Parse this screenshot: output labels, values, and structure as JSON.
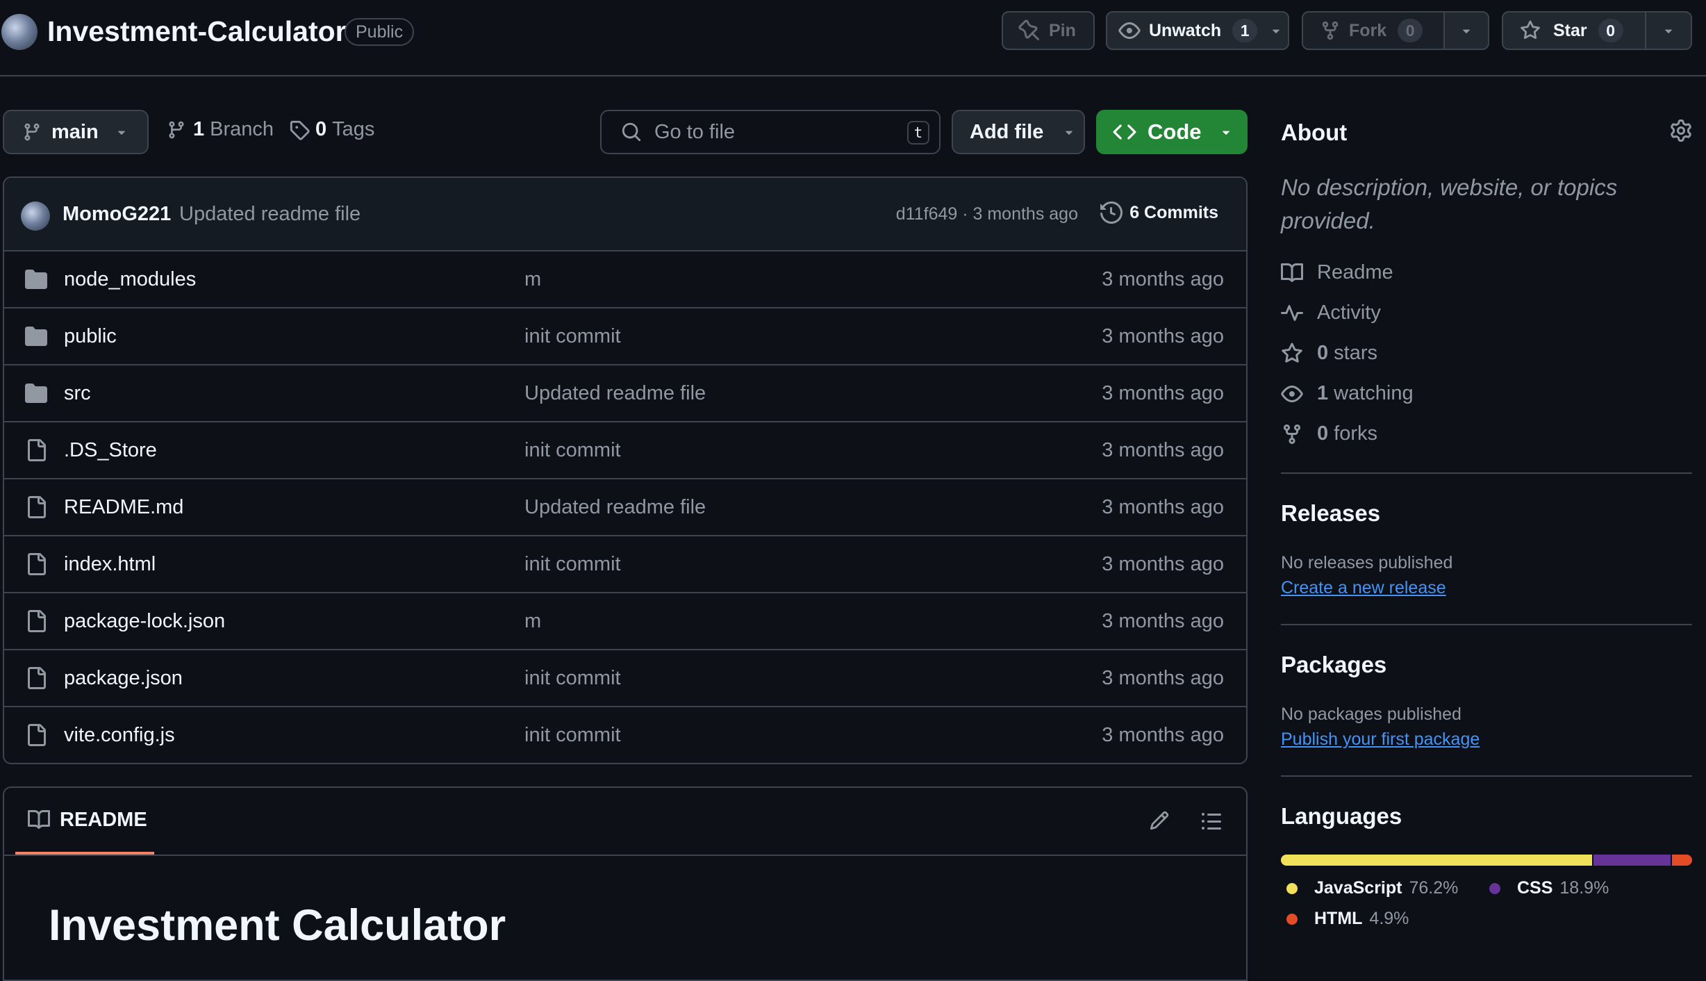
{
  "repo": {
    "name": "Investment-Calculator",
    "visibility": "Public"
  },
  "header_actions": {
    "pin_label": "Pin",
    "unwatch_label": "Unwatch",
    "unwatch_count": "1",
    "fork_label": "Fork",
    "fork_count": "0",
    "star_label": "Star",
    "star_count": "0"
  },
  "toolbar": {
    "branch": "main",
    "branches_count": "1",
    "branches_label": "Branch",
    "tags_count": "0",
    "tags_label": "Tags",
    "search_placeholder": "Go to file",
    "search_shortcut": "t",
    "add_file_label": "Add file",
    "code_label": "Code"
  },
  "latest_commit": {
    "author": "MomoG221",
    "message": "Updated readme file",
    "meta": "d11f649 · 3 months ago",
    "commits_label": "6 Commits"
  },
  "files": [
    {
      "name": "node_modules",
      "type": "folder",
      "message": "m",
      "date": "3 months ago"
    },
    {
      "name": "public",
      "type": "folder",
      "message": "init commit",
      "date": "3 months ago"
    },
    {
      "name": "src",
      "type": "folder",
      "message": "Updated readme file",
      "date": "3 months ago"
    },
    {
      "name": ".DS_Store",
      "type": "file",
      "message": "init commit",
      "date": "3 months ago"
    },
    {
      "name": "README.md",
      "type": "file",
      "message": "Updated readme file",
      "date": "3 months ago"
    },
    {
      "name": "index.html",
      "type": "file",
      "message": "init commit",
      "date": "3 months ago"
    },
    {
      "name": "package-lock.json",
      "type": "file",
      "message": "m",
      "date": "3 months ago"
    },
    {
      "name": "package.json",
      "type": "file",
      "message": "init commit",
      "date": "3 months ago"
    },
    {
      "name": "vite.config.js",
      "type": "file",
      "message": "init commit",
      "date": "3 months ago"
    }
  ],
  "readme": {
    "tab_label": "README",
    "heading": "Investment Calculator"
  },
  "about": {
    "title": "About",
    "description": "No description, website, or topics provided.",
    "readme_label": "Readme",
    "activity_label": "Activity",
    "stars_count": "0",
    "stars_label": "stars",
    "watching_count": "1",
    "watching_label": "watching",
    "forks_count": "0",
    "forks_label": "forks"
  },
  "releases": {
    "title": "Releases",
    "note": "No releases published",
    "link": "Create a new release"
  },
  "packages": {
    "title": "Packages",
    "note": "No packages published",
    "link": "Publish your first package"
  },
  "languages": {
    "title": "Languages",
    "items": [
      {
        "name": "JavaScript",
        "percent": "76.2%",
        "value": 76.2,
        "color": "#f1e05a"
      },
      {
        "name": "CSS",
        "percent": "18.9%",
        "value": 18.9,
        "color": "#663399"
      },
      {
        "name": "HTML",
        "percent": "4.9%",
        "value": 4.9,
        "color": "#e34c26"
      }
    ]
  },
  "icons": {
    "folder": "folder-icon",
    "file": "file-icon",
    "pin": "pin-icon",
    "eye": "eye-icon",
    "fork": "fork-icon",
    "star": "star-icon",
    "branch": "branch-icon",
    "tag": "tag-icon",
    "search": "search-icon",
    "history": "history-icon",
    "book": "book-icon",
    "pulse": "pulse-icon",
    "gear": "gear-icon",
    "pencil": "pencil-icon",
    "list": "list-icon"
  }
}
